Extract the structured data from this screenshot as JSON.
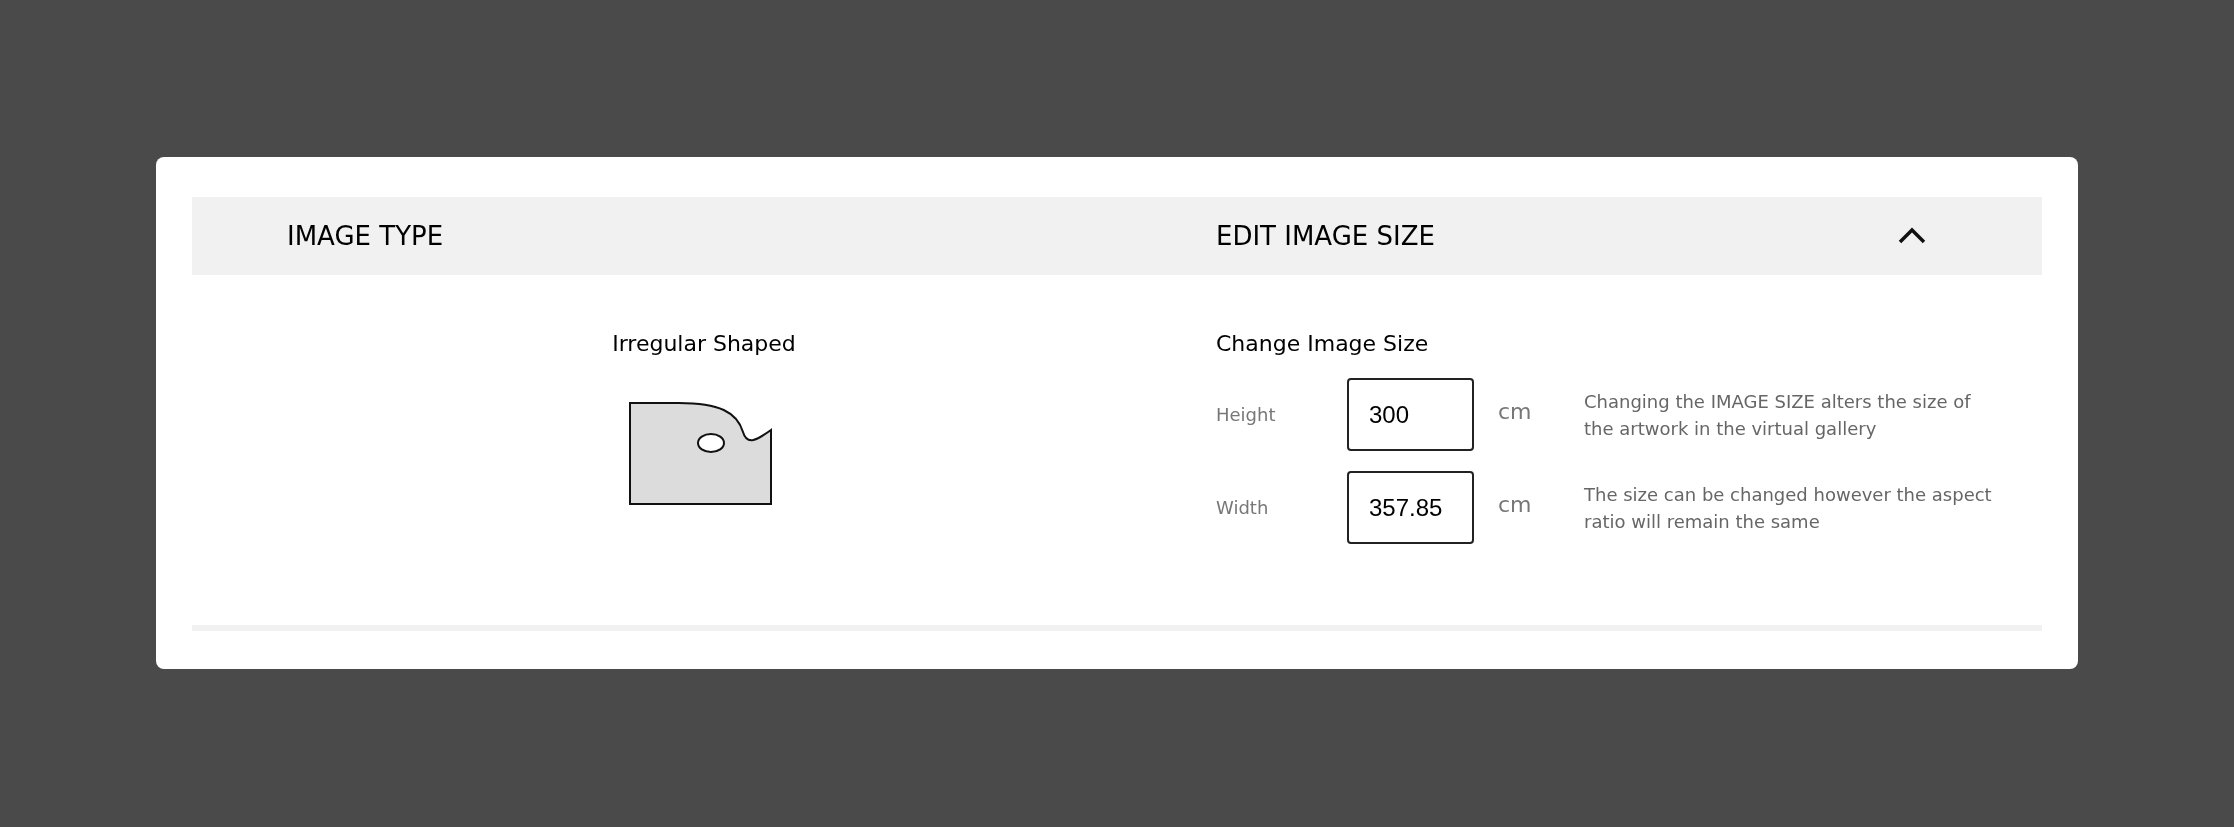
{
  "image_type": {
    "heading": "IMAGE TYPE",
    "shape_label": "Irregular Shaped"
  },
  "edit_size": {
    "heading": "EDIT IMAGE SIZE",
    "expanded": true,
    "subheading": "Change Image Size",
    "fields": [
      {
        "label": "Height",
        "value": "300",
        "unit": "cm",
        "note": "Changing the IMAGE SIZE alters the size of the artwork in the virtual gallery"
      },
      {
        "label": "Width",
        "value": "357.85",
        "unit": "cm",
        "note": "The size can be changed however the aspect ratio will remain the same"
      }
    ]
  }
}
